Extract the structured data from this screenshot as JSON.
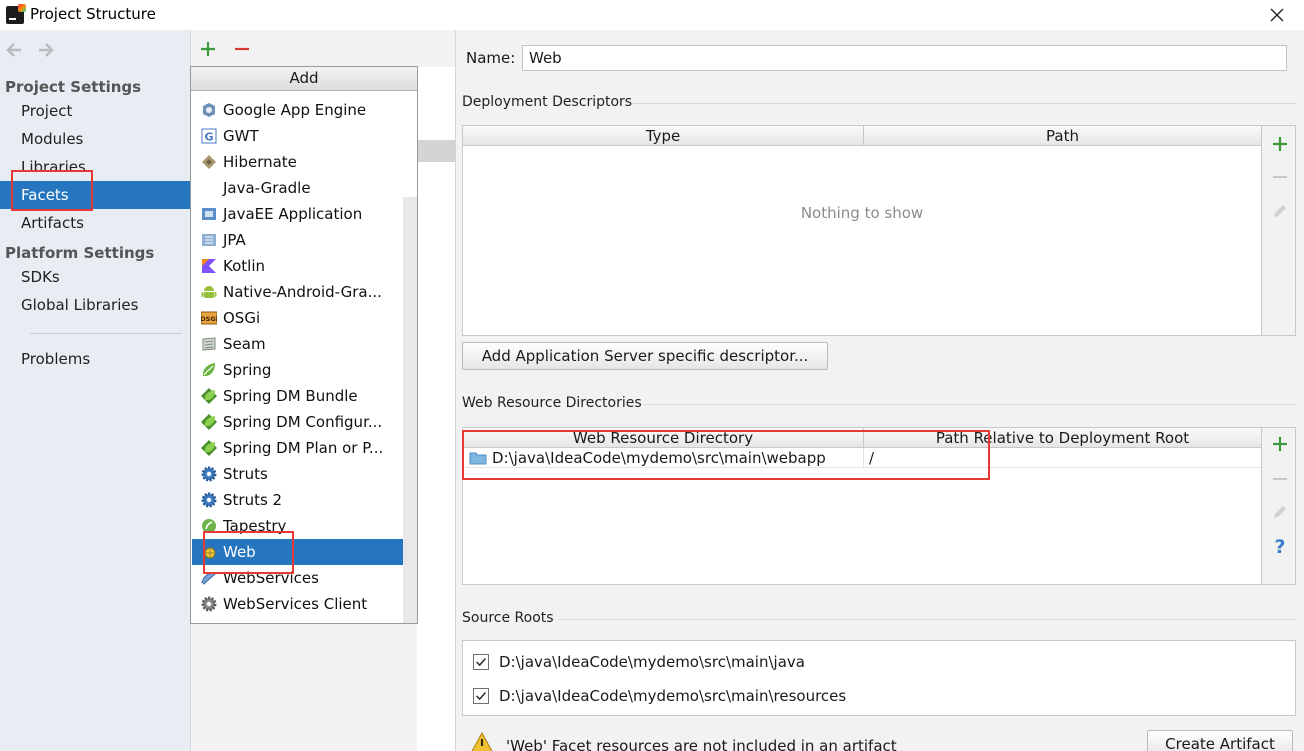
{
  "window": {
    "title": "Project Structure"
  },
  "sidebar": {
    "sections": [
      {
        "label": "Project Settings",
        "items": [
          "Project",
          "Modules",
          "Libraries",
          "Facets",
          "Artifacts"
        ]
      },
      {
        "label": "Platform Settings",
        "items": [
          "SDKs",
          "Global Libraries"
        ]
      }
    ],
    "problems": "Problems",
    "selected": "Facets"
  },
  "popup": {
    "title": "Add",
    "items": [
      {
        "label": "Google App Engine",
        "icon": "google-app-engine-icon"
      },
      {
        "label": "GWT",
        "icon": "gwt-icon"
      },
      {
        "label": "Hibernate",
        "icon": "hibernate-icon"
      },
      {
        "label": "Java-Gradle",
        "icon": ""
      },
      {
        "label": "JavaEE Application",
        "icon": "javaee-icon"
      },
      {
        "label": "JPA",
        "icon": "jpa-icon"
      },
      {
        "label": "Kotlin",
        "icon": "kotlin-icon"
      },
      {
        "label": "Native-Android-Gra...",
        "icon": "android-icon"
      },
      {
        "label": "OSGi",
        "icon": "osgi-icon"
      },
      {
        "label": "Seam",
        "icon": "seam-icon"
      },
      {
        "label": "Spring",
        "icon": "spring-icon"
      },
      {
        "label": "Spring DM Bundle",
        "icon": "spring-dm-icon"
      },
      {
        "label": "Spring DM Configur...",
        "icon": "spring-dm-icon"
      },
      {
        "label": "Spring DM Plan or P...",
        "icon": "spring-dm-icon"
      },
      {
        "label": "Struts",
        "icon": "struts-gear-icon"
      },
      {
        "label": "Struts 2",
        "icon": "struts-gear-icon"
      },
      {
        "label": "Tapestry",
        "icon": "tapestry-icon"
      },
      {
        "label": "Web",
        "icon": "web-icon"
      },
      {
        "label": "WebServices",
        "icon": "webservices-icon"
      },
      {
        "label": "WebServices Client",
        "icon": "webservices-client-icon"
      }
    ],
    "selected": "Web"
  },
  "facet": {
    "name_label": "Name:",
    "name_value": "Web",
    "deployment_descriptors": {
      "label": "Deployment Descriptors",
      "columns": [
        "Type",
        "Path"
      ],
      "empty_text": "Nothing to show",
      "add_button": "Add Application Server specific descriptor..."
    },
    "web_resource_directories": {
      "label": "Web Resource Directories",
      "columns": [
        "Web Resource Directory",
        "Path Relative to Deployment Root"
      ],
      "rows": [
        {
          "directory": "D:\\java\\IdeaCode\\mydemo\\src\\main\\webapp",
          "path": "/"
        }
      ]
    },
    "source_roots": {
      "label": "Source Roots",
      "items": [
        {
          "path": "D:\\java\\IdeaCode\\mydemo\\src\\main\\java",
          "checked": true
        },
        {
          "path": "D:\\java\\IdeaCode\\mydemo\\src\\main\\resources",
          "checked": true
        }
      ]
    },
    "warning": "'Web' Facet resources are not included in an artifact",
    "create_artifact": "Create Artifact"
  },
  "colors": {
    "selection": "#2675bf",
    "add_green": "#3c9a3c",
    "remove_red": "#d9382f",
    "highlight_box": "#e53935"
  }
}
